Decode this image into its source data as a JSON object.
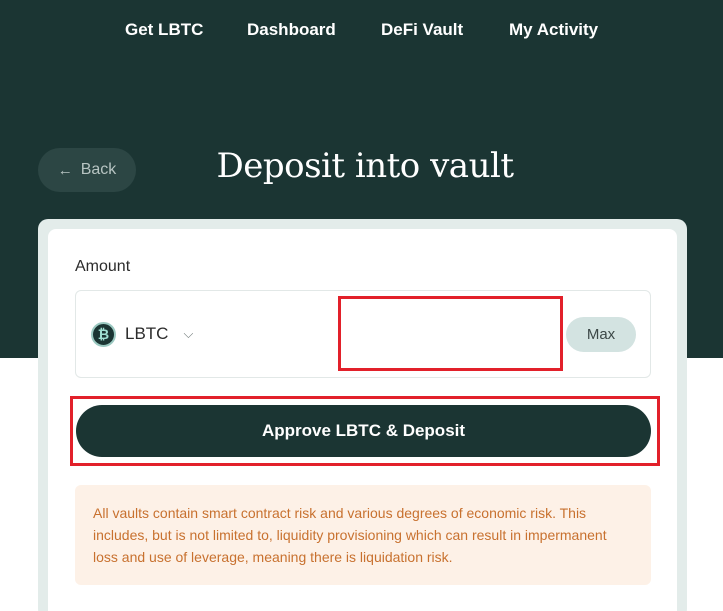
{
  "nav": {
    "items": [
      {
        "label": "Get LBTC"
      },
      {
        "label": "Dashboard"
      },
      {
        "label": "DeFi Vault"
      },
      {
        "label": "My Activity"
      }
    ]
  },
  "header": {
    "back_label": "Back",
    "back_arrow": "←",
    "title": "Deposit into vault"
  },
  "form": {
    "amount_label": "Amount",
    "token": {
      "symbol": "LBTC",
      "icon": "bitcoin-icon",
      "icon_glyph": "₿",
      "chevron_glyph": "⌵"
    },
    "amount_value": "",
    "max_label": "Max",
    "approve_label": "Approve LBTC & Deposit"
  },
  "warning": {
    "text": "All vaults contain smart contract risk and various degrees of economic risk. This includes, but is not limited to, liquidity provisioning which can result in impermanent loss and use of leverage, meaning there is liquidation risk."
  },
  "colors": {
    "hero_bg": "#1b3533",
    "primary_button": "#1b3533",
    "warning_bg": "#fdf1e7",
    "warning_text": "#c8712f",
    "highlight": "#e2202a"
  }
}
